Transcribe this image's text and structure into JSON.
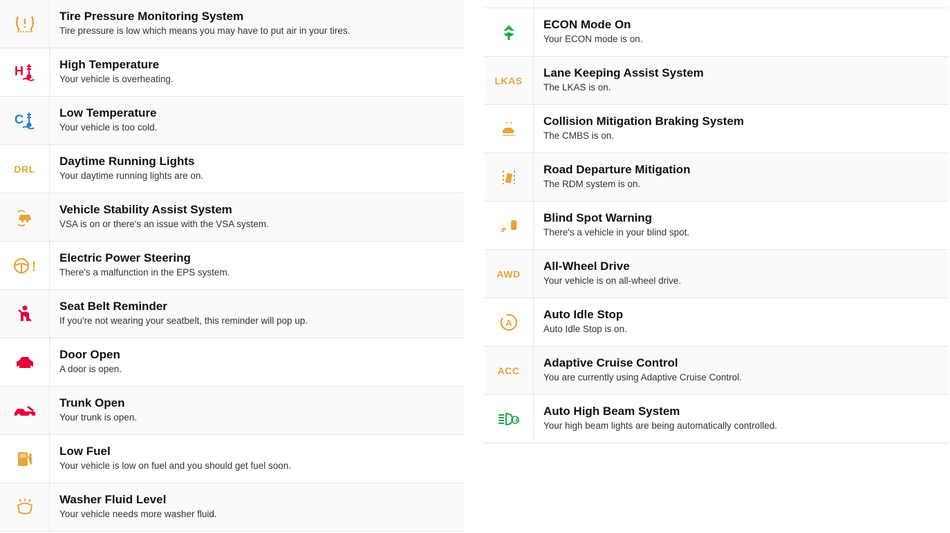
{
  "left": [
    {
      "title": "Tire Pressure Monitoring System",
      "desc": "Tire pressure is low which means you may have to put air in your tires."
    },
    {
      "title": "High Temperature",
      "desc": "Your vehicle is overheating."
    },
    {
      "title": "Low Temperature",
      "desc": "Your vehicle is too cold."
    },
    {
      "title": "Daytime Running Lights",
      "desc": "Your daytime running lights are on."
    },
    {
      "title": "Vehicle Stability Assist System",
      "desc": "VSA is on or there's an issue with the VSA system."
    },
    {
      "title": "Electric Power Steering",
      "desc": "There's a malfunction in the EPS system."
    },
    {
      "title": "Seat Belt Reminder",
      "desc": "If you're not wearing your seatbelt, this reminder will pop up."
    },
    {
      "title": "Door Open",
      "desc": "A door is open."
    },
    {
      "title": "Trunk Open",
      "desc": "Your trunk is open."
    },
    {
      "title": "Low Fuel",
      "desc": "Your vehicle is low on fuel and you should get fuel soon."
    },
    {
      "title": "Washer Fluid Level",
      "desc": "Your vehicle needs more washer fluid."
    }
  ],
  "right": [
    {
      "title": "ECON Mode On",
      "desc": "Your ECON mode is on."
    },
    {
      "title": "Lane Keeping Assist System",
      "desc": "The LKAS is on."
    },
    {
      "title": "Collision Mitigation Braking System",
      "desc": "The CMBS is on."
    },
    {
      "title": "Road Departure Mitigation",
      "desc": "The RDM system is on."
    },
    {
      "title": "Blind Spot Warning",
      "desc": "There's a vehicle in your blind spot."
    },
    {
      "title": "All-Wheel Drive",
      "desc": "Your vehicle is on all-wheel drive."
    },
    {
      "title": "Auto Idle Stop",
      "desc": "Auto Idle Stop is on."
    },
    {
      "title": "Adaptive Cruise Control",
      "desc": "You are currently using Adaptive Cruise Control."
    },
    {
      "title": "Auto High Beam System",
      "desc": "Your high beam lights are being automatically controlled."
    }
  ],
  "labels": {
    "drl": "DRL",
    "lkas": "LKAS",
    "awd": "AWD",
    "acc": "ACC"
  }
}
